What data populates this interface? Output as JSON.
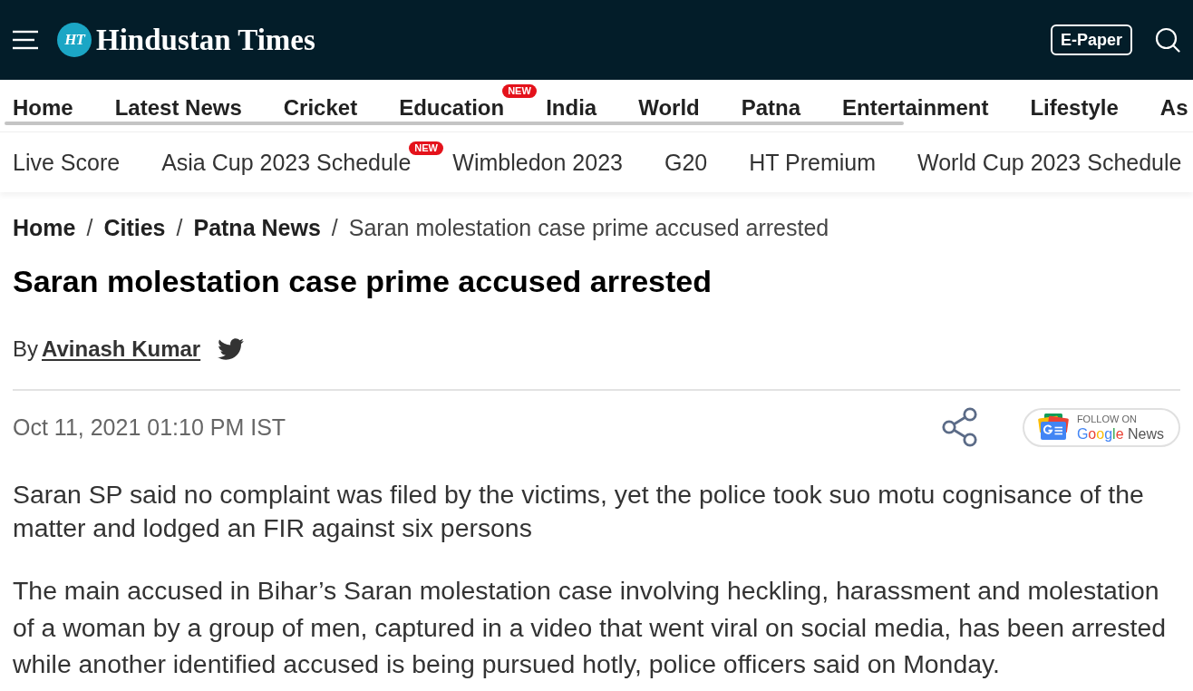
{
  "header": {
    "logo": {
      "mark": "HT",
      "wordmark": "Hindustan Times"
    },
    "epaper_button": "E-Paper"
  },
  "primary_nav": [
    {
      "label": "Home"
    },
    {
      "label": "Latest News"
    },
    {
      "label": "Cricket"
    },
    {
      "label": "Education",
      "badge": "NEW"
    },
    {
      "label": "India"
    },
    {
      "label": "World"
    },
    {
      "label": "Patna"
    },
    {
      "label": "Entertainment"
    },
    {
      "label": "Lifestyle"
    },
    {
      "label": "As"
    }
  ],
  "secondary_nav": [
    {
      "label": "Live Score"
    },
    {
      "label": "Asia Cup 2023 Schedule",
      "badge": "NEW"
    },
    {
      "label": "Wimbledon 2023"
    },
    {
      "label": "G20"
    },
    {
      "label": "HT Premium"
    },
    {
      "label": "World Cup 2023 Schedule"
    }
  ],
  "breadcrumb": [
    {
      "label": "Home",
      "current": false,
      "separator": "/"
    },
    {
      "label": "Cities",
      "current": false,
      "separator": "/"
    },
    {
      "label": "Patna News",
      "current": false,
      "separator": "/"
    },
    {
      "label": "Saran molestation case prime accused arrested",
      "current": true
    }
  ],
  "article": {
    "title": "Saran molestation case prime accused arrested",
    "byline": {
      "prefix": "By",
      "author": "Avinash Kumar"
    },
    "date": "Oct 11, 2021 01:10 PM IST",
    "follow_button": {
      "caption": "FOLLOW ON",
      "brand": "Google",
      "service": "News"
    },
    "summary": "Saran SP said no complaint was filed by the victims, yet the police took suo motu cognisance of the matter and lodged an FIR against six persons",
    "paragraphs": [
      "The main accused in Bihar’s Saran molestation case involving heckling, harassment and molestation of a woman by a group of men, captured in a video that went viral on social media, has been arrested while another identified accused is being pursued hotly, police officers said on Monday."
    ]
  }
}
